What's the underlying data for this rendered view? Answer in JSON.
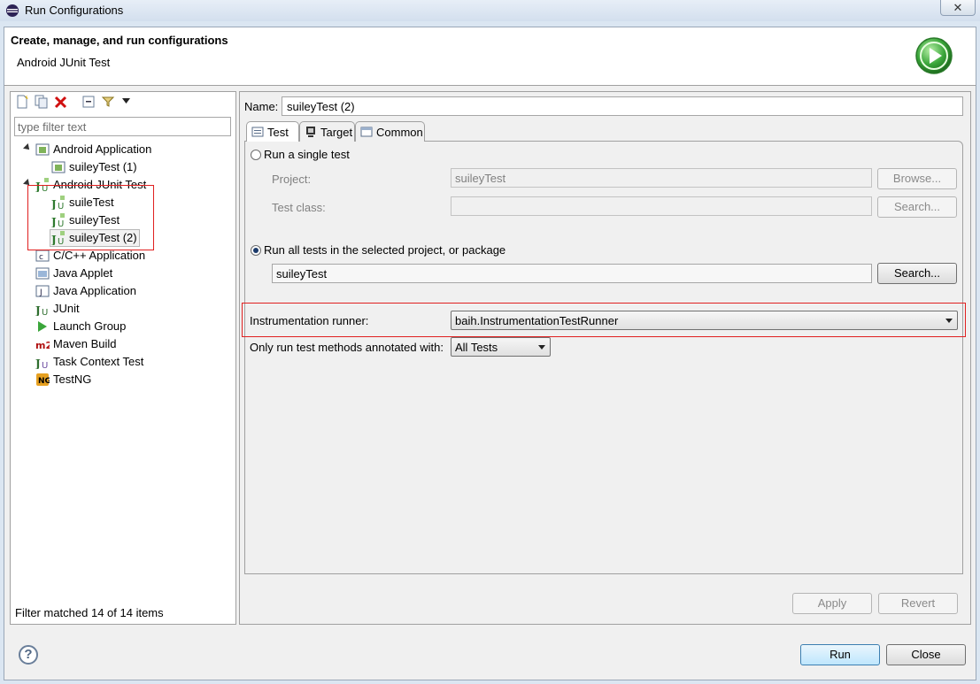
{
  "window": {
    "title": "Run Configurations",
    "close_symbol": "✕"
  },
  "header": {
    "title": "Create, manage, and run configurations",
    "subtitle": "Android JUnit Test"
  },
  "left": {
    "filter_placeholder": "type filter text",
    "tree": [
      {
        "label": "Android Application",
        "icon": "android-app-icon",
        "expanded": true
      },
      {
        "label": "suileyTest (1)",
        "icon": "android-app-config-icon"
      },
      {
        "label": "Android JUnit Test",
        "icon": "android-junit-icon",
        "expanded": true
      },
      {
        "label": "suileTest",
        "icon": "junit-config-icon"
      },
      {
        "label": "suileyTest",
        "icon": "junit-config-icon"
      },
      {
        "label": "suileyTest (2)",
        "icon": "junit-config-icon",
        "selected": true
      },
      {
        "label": "C/C++ Application",
        "icon": "c-app-icon"
      },
      {
        "label": "Java Applet",
        "icon": "java-applet-icon"
      },
      {
        "label": "Java Application",
        "icon": "java-app-icon"
      },
      {
        "label": "JUnit",
        "icon": "junit-icon"
      },
      {
        "label": "Launch Group",
        "icon": "launch-group-icon"
      },
      {
        "label": "Maven Build",
        "icon": "maven-icon"
      },
      {
        "label": "Task Context Test",
        "icon": "task-context-icon"
      },
      {
        "label": "TestNG",
        "icon": "testng-icon"
      }
    ],
    "status": "Filter matched 14 of 14 items"
  },
  "right": {
    "name_label": "Name:",
    "name_value": "suileyTest (2)",
    "tabs": [
      {
        "label": "Test",
        "active": true
      },
      {
        "label": "Target",
        "active": false
      },
      {
        "label": "Common",
        "active": false
      }
    ],
    "single_test": {
      "label": "Run a single test",
      "project_label": "Project:",
      "project_value": "suileyTest",
      "test_class_label": "Test class:",
      "browse_label": "Browse...",
      "search_label": "Search..."
    },
    "all_tests": {
      "label": "Run all tests in the selected project, or package",
      "value": "suileyTest",
      "search_label": "Search..."
    },
    "instrumentation": {
      "label": "Instrumentation runner:",
      "value": "baih.InstrumentationTestRunner"
    },
    "annotated": {
      "label": "Only run test methods annotated with:",
      "value": "All Tests"
    },
    "apply_label": "Apply",
    "revert_label": "Revert"
  },
  "footer": {
    "help_symbol": "?",
    "run_label": "Run",
    "close_label": "Close"
  },
  "colors": {
    "highlight_red": "#e02020",
    "run_green": "#3aa63a"
  }
}
